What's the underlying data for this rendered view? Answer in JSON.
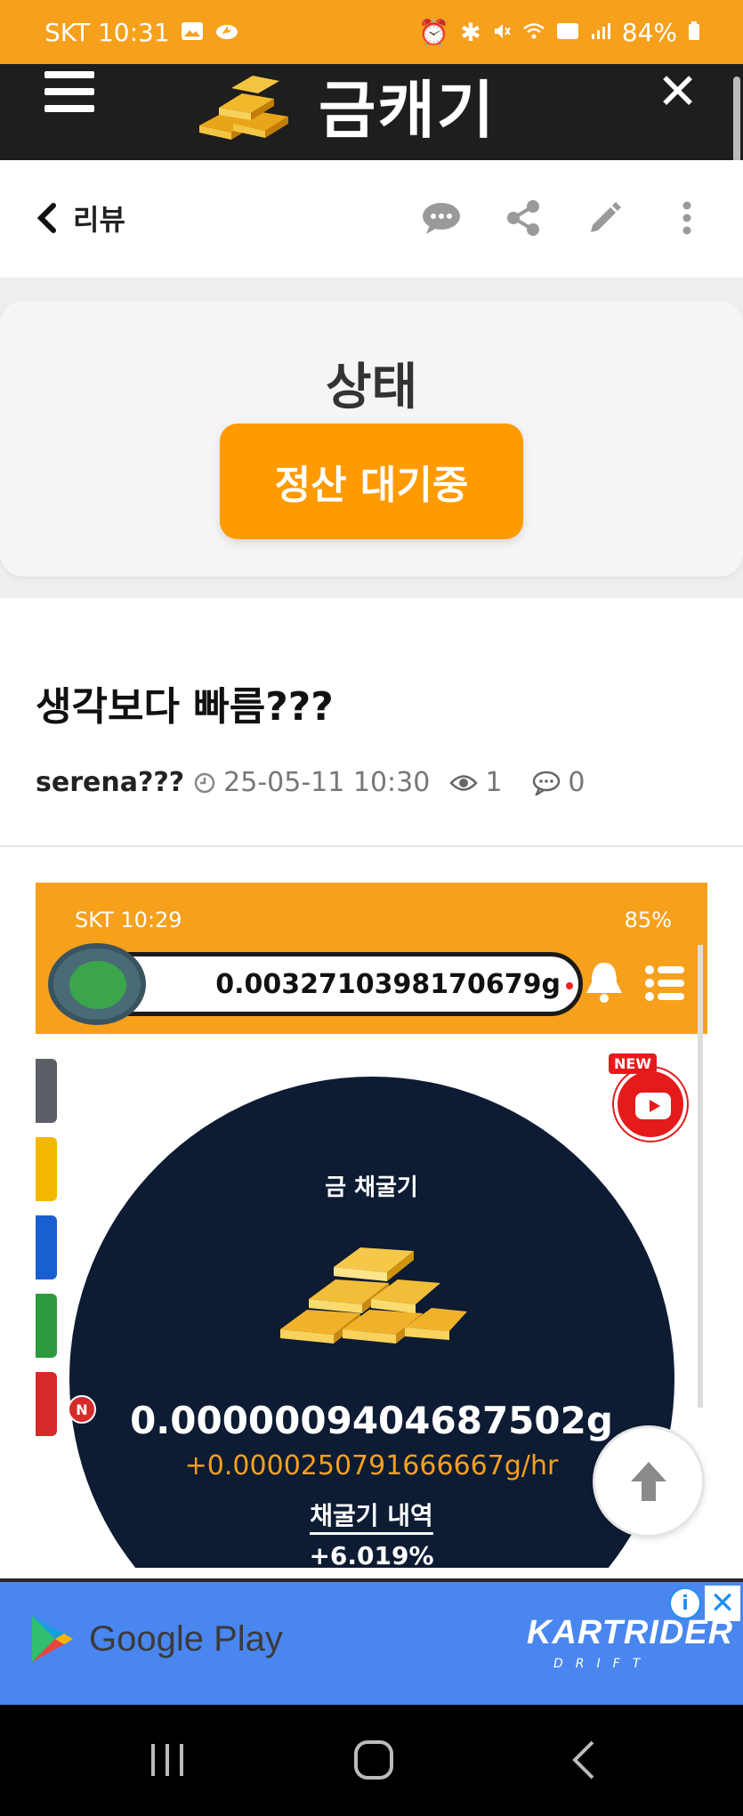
{
  "status_bar": {
    "carrier_time": "SKT 10:31",
    "battery": "84%"
  },
  "app_header": {
    "title": "금캐기"
  },
  "nav": {
    "back_label": "리뷰"
  },
  "status_card": {
    "title": "상태",
    "badge": "정산 대기중"
  },
  "post": {
    "title": "생각보다 빠름???",
    "author": "serena???",
    "datetime": "25-05-11 10:30",
    "views": "1",
    "comments": "0"
  },
  "embedded_screenshot": {
    "carrier_time": "SKT 10:29",
    "battery": "85%",
    "balance": "0.0032710398170679g",
    "new_badge": "NEW",
    "section_title": "금 채굴기",
    "grams": "0.0000009404687502g",
    "rate": "+0.0000250791666667g/hr",
    "history_label": "채굴기 내역",
    "percent": "+6.019%",
    "n_badge": "N"
  },
  "ad": {
    "store_label": "Google Play",
    "brand_label": "KARTRIDER",
    "brand_sub": "DRIFT",
    "info": "i",
    "close": "✕"
  },
  "icons": {
    "comment": "comment-icon",
    "share": "share-icon",
    "edit": "pencil-icon",
    "more": "more-vertical-icon"
  },
  "colors": {
    "brand_orange": "#f6a01c",
    "button_orange": "#ff9a00",
    "header_dark": "#1e1e1e",
    "mining_navy": "#0d1b33"
  }
}
